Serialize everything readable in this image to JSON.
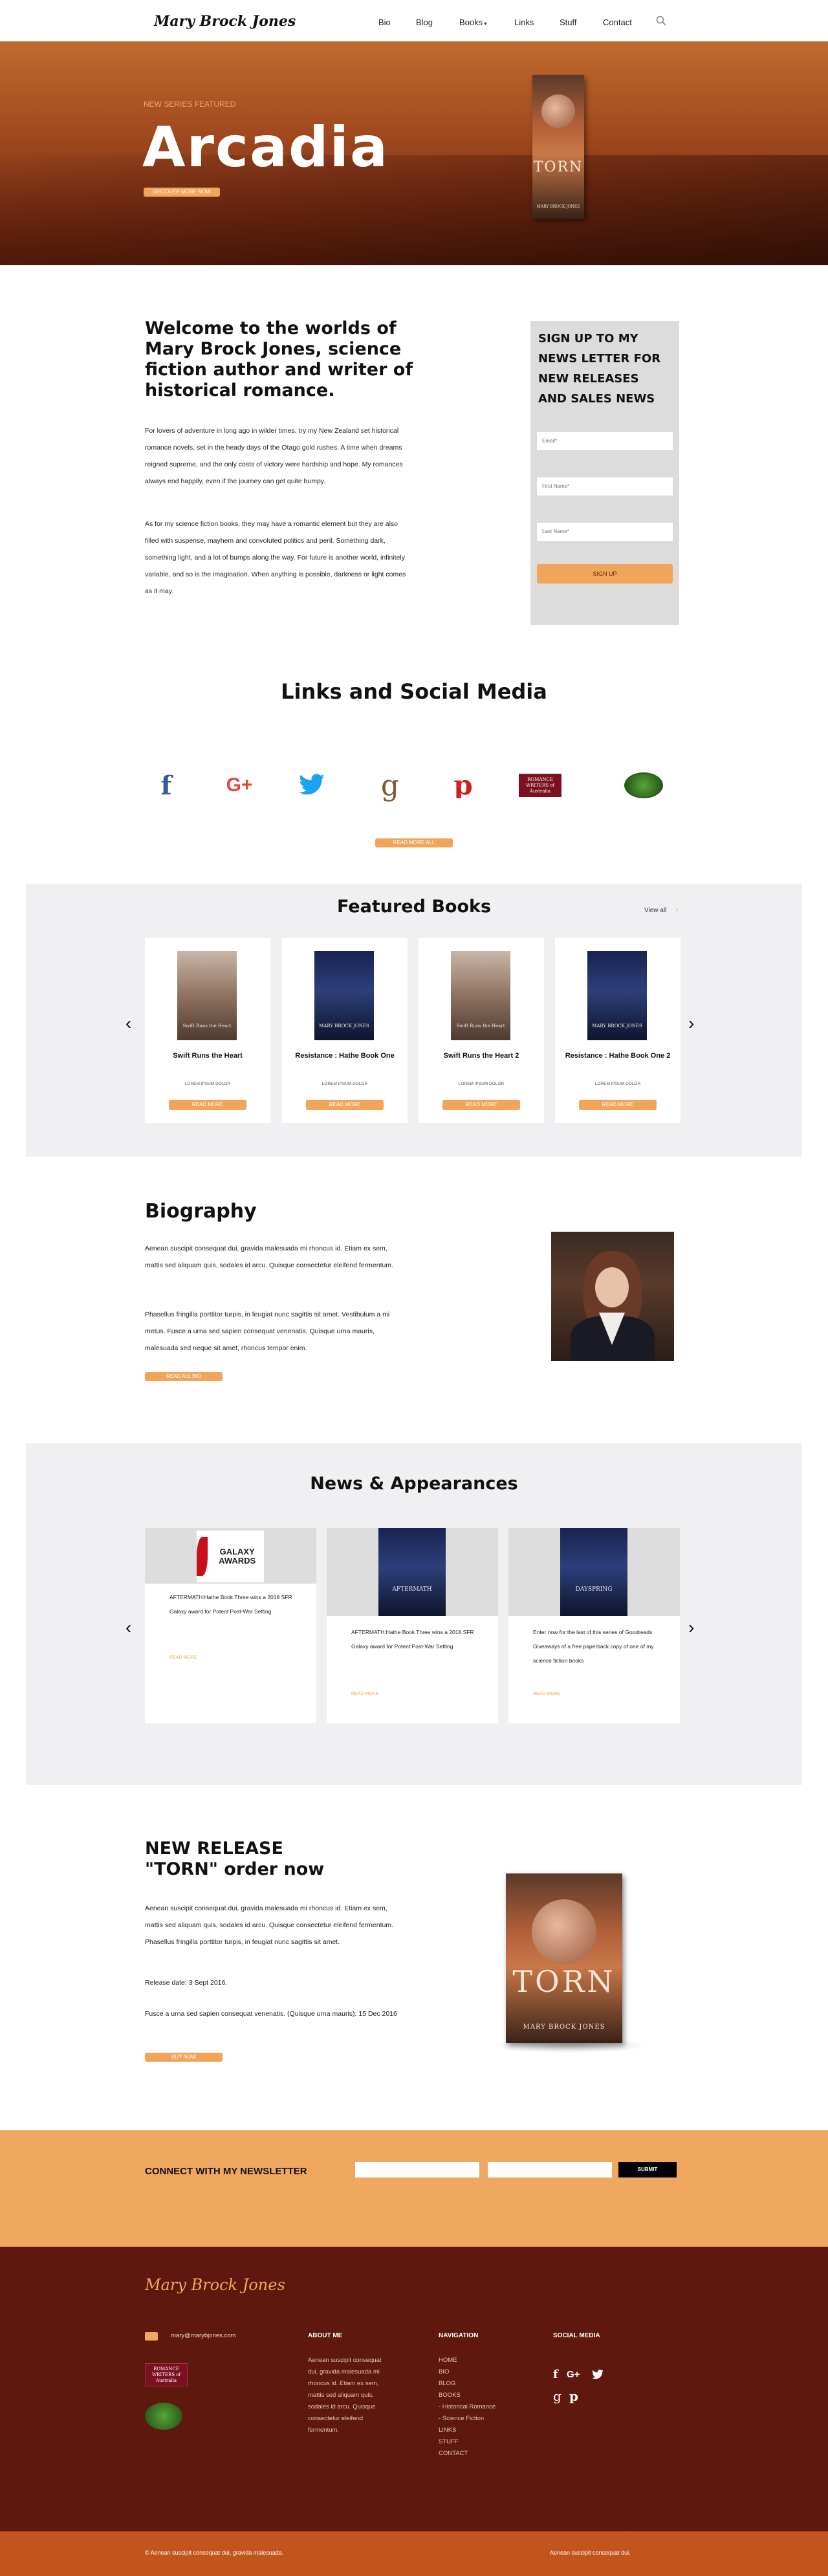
{
  "header": {
    "logo": "Mary Brock Jones",
    "nav": [
      "Bio",
      "Blog",
      "Books",
      "Links",
      "Stuff",
      "Contact"
    ]
  },
  "hero": {
    "kicker": "NEW SERIES FEATURED",
    "title": "Arcadia",
    "button": "DISCOVER MORE NOW",
    "book_title": "TORN",
    "book_author": "MARY BROCK JONES"
  },
  "welcome": {
    "title": "Welcome to the worlds of Mary Brock Jones, science fiction author and writer of historical romance.",
    "p1": "For lovers of adventure in long ago in wilder times, try my New Zealand set historical romance novels, set in the heady days of the Otago gold rushes. A time when dreams reigned supreme, and the only costs of victory were hardship and hope. My romances always end happily, even if the journey can get quite bumpy.",
    "p2": "As for my science fiction books, they may have a romantic element but they are also filled with suspense, mayhem and convoluted politics and peril. Something dark, something light, and a lot of bumps along the way. For future is another world, infinitely variable, and so is the imagination. When anything is possible, darkness or light comes as it may."
  },
  "signup": {
    "title": "SIGN UP TO MY NEWS LETTER FOR NEW RELEASES AND SALES NEWS",
    "email": "Email*",
    "first": "First Name*",
    "last": "Last Name*",
    "button": "SIGN UP"
  },
  "social": {
    "title": "Links and Social Media",
    "button": "READ MORE ALL",
    "rwa": "ROMANCE WRITERS of Australia"
  },
  "featured": {
    "title": "Featured Books",
    "view_all": "View all",
    "books": [
      {
        "title": "Swift Runs the Heart",
        "sub": "LOREM IPSUM DOLOR",
        "btn": "READ MORE",
        "cover": "r",
        "ct": "Swift Runs the Heart"
      },
      {
        "title": "Resistance : Hathe Book One",
        "sub": "LOREM IPSUM DOLOR",
        "btn": "READ MORE",
        "cover": "b",
        "ct": "MARY BROCK JONES"
      },
      {
        "title": "Swift Runs the Heart 2",
        "sub": "LOREM IPSUM DOLOR",
        "btn": "READ MORE",
        "cover": "r",
        "ct": "Swift Runs the Heart"
      },
      {
        "title": "Resistance : Hathe Book One 2",
        "sub": "LOREM IPSUM DOLOR",
        "btn": "READ MORE",
        "cover": "b",
        "ct": "MARY BROCK JONES"
      }
    ]
  },
  "bio": {
    "title": "Biography",
    "p1": "Aenean suscipit consequat dui, gravida malesuada mi rhoncus id. Etiam ex sem, mattis sed aliquam quis, sodales id arcu. Quisque consectetur eleifend fermentum.",
    "p2": "Phasellus fringilla porttitor turpis, in feugiat nunc sagittis sit amet. Vestibulum a mi metus. Fusce a urna sed sapien consequat venenatis. Quisque urna mauris, malesuada sed neque sit amet, rhoncus tempor enim.",
    "button": "READ ALL BIO"
  },
  "news": {
    "title": "News & Appearances",
    "items": [
      {
        "text": "AFTERMATH:Hathe Book Three wins a 2018 SFR Galaxy award for Potent Post-War Setting",
        "link": "READ MORE",
        "img": "GALAXY AWARDS"
      },
      {
        "text": "AFTERMATH:Hathe Book Three wins a 2018 SFR Galaxy award for Potent Post-War Setting",
        "link": "READ MORE",
        "img": "AFTERMATH"
      },
      {
        "text": "Enter now for the last of this series of Goodreads Giveaways of a free paperback copy of one of my science fiction books",
        "link": "READ MORE",
        "img": "DAYSPRING"
      }
    ]
  },
  "release": {
    "title1": "NEW RELEASE",
    "title2": "\"TORN\" order now",
    "p1": "Aenean suscipit consequat dui, gravida malesuada mi rhoncus id. Etiam ex sem, mattis sed aliquam quis, sodales id arcu. Quisque consectetur eleifend fermentum. Phasellus fringilla porttitor turpis, in feugiat nunc sagittis sit amet.",
    "date": "Release date: 3 Sept 2016.",
    "p3": "Fusce a urna sed sapien consequat venenatis. (Quisque urna mauris): 15 Dec 2016",
    "button": "BUY NOW",
    "book_title": "TORN",
    "book_author": "MARY BROCK JONES"
  },
  "connect": {
    "title": "CONNECT WITH MY NEWSLETTER",
    "submit": "SUBMIT"
  },
  "footer": {
    "logo": "Mary Brock Jones",
    "email": "mary@marybjones.com",
    "about_h": "ABOUT ME",
    "about": "Aenean suscipit consequat dui, gravida malesuada mi rhoncus id. Etiam ex sem, mattis sed aliquam quis, sodales id arcu. Quisque consectetur eleifend fermentum.",
    "nav_h": "NAVIGATION",
    "nav": [
      "HOME",
      "BIO",
      "BLOG",
      "BOOKS",
      "- Historical Romance",
      "- Science Fiction",
      "LINKS",
      "STUFF",
      "CONTACT"
    ],
    "social_h": "SOCIAL MEDIA",
    "bottom_left": "© Aenean suscipit consequat dui, gravida malesuada.",
    "bottom_right": "Aenean suscipit consequat dui."
  },
  "colors": {
    "accent": "#f0a55a",
    "footer": "#5e180d",
    "footer_bottom": "#c3541e",
    "grey": "#f0f0f3"
  }
}
